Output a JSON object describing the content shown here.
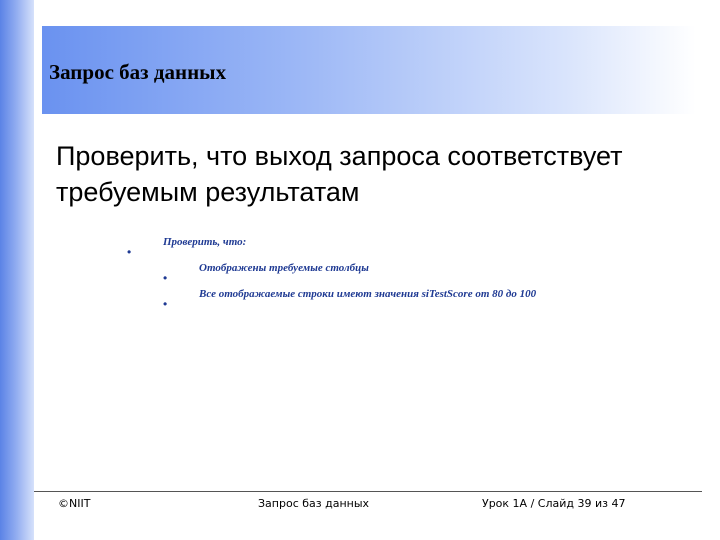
{
  "slide": {
    "title": "Запрос баз данных",
    "heading": "Проверить, что выход запроса соответствует требуемым результатам",
    "bullets": [
      {
        "text": "Проверить, что:",
        "level": 1
      },
      {
        "text": "Отображены требуемые столбцы",
        "level": 2
      },
      {
        "text": "Все отображаемые строки имеют значения siTestScore от 80 до 100",
        "level": 2
      }
    ],
    "bullet_symbol": "•"
  },
  "footer": {
    "copyright": "©NIIT",
    "topic": "Запрос баз данных",
    "slide_info": "Урок 1A / Слайд 39 из 47"
  },
  "colors": {
    "accent_blue": "#5b83e6",
    "bullet_text": "#1f3a93"
  }
}
